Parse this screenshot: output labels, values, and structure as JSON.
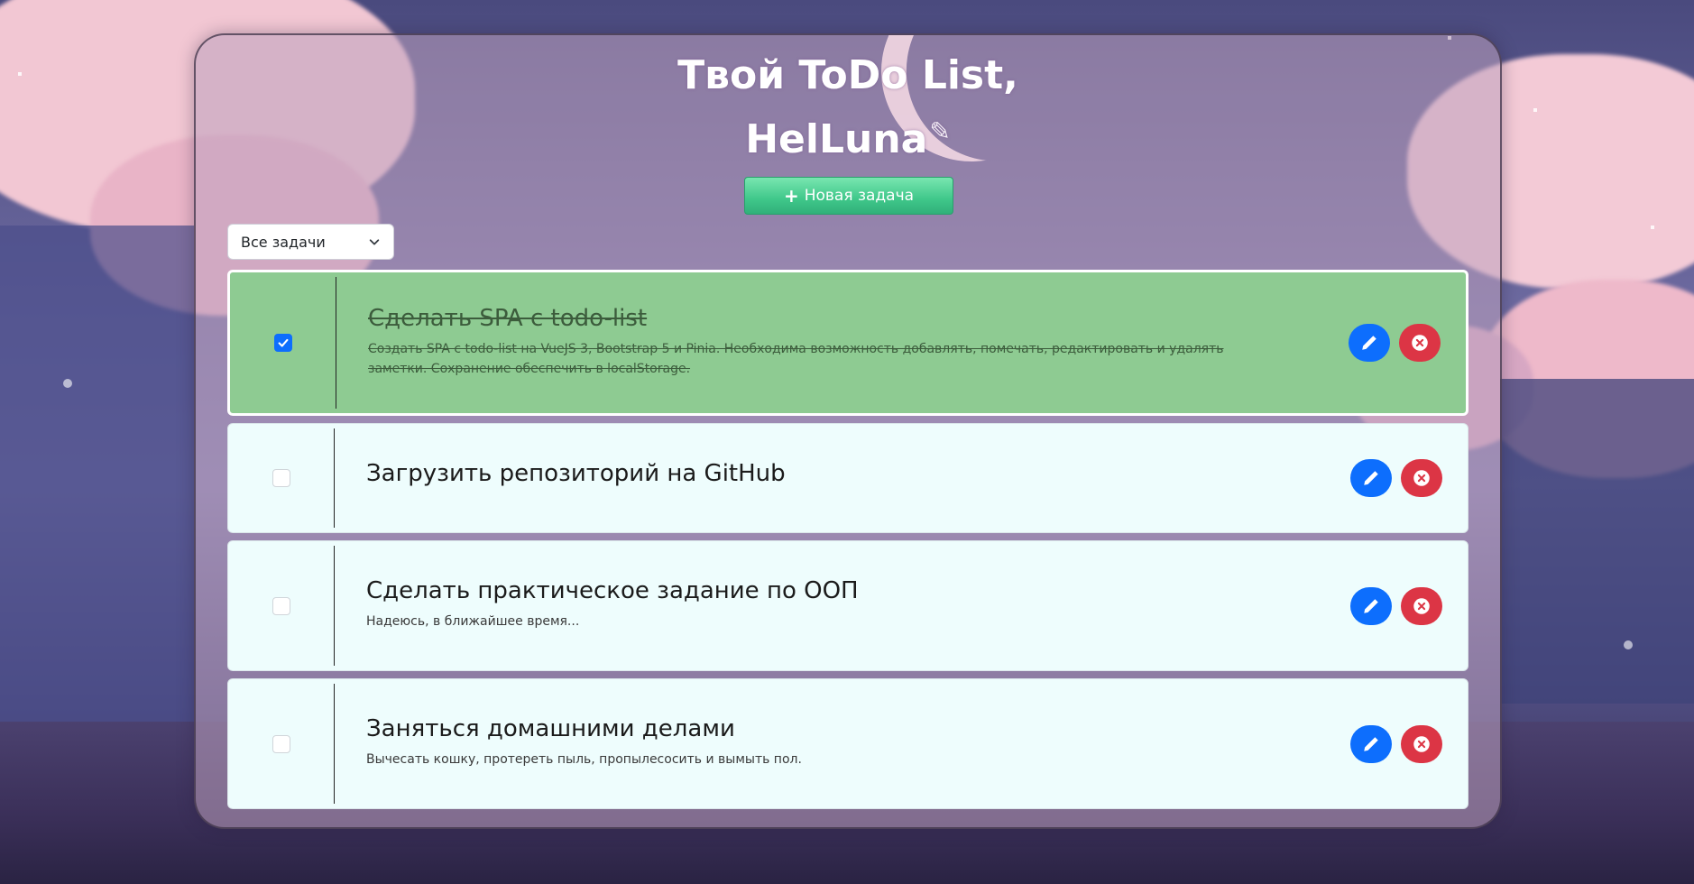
{
  "header": {
    "title_line1": "Твой ToDo List,",
    "title_line2": "HelLuna",
    "edit_icon": "pencil-icon"
  },
  "toolbar": {
    "new_task_label": "Новая задача",
    "new_task_icon": "plus-icon"
  },
  "filter": {
    "selected": "Все задачи"
  },
  "tasks": [
    {
      "title": "Сделать SPA с todo-list",
      "description": "Создать SPA с todo-list на VueJS 3, Bootstrap 5 и Pinia. Необходима возможность добавлять, помечать, редактировать и удалять заметки. Сохранение обеспечить в localStorage.",
      "done": true
    },
    {
      "title": "Загрузить репозиторий на GitHub",
      "description": "",
      "done": false
    },
    {
      "title": "Сделать практическое задание по ООП",
      "description": "Надеюсь, в ближайшее время...",
      "done": false
    },
    {
      "title": "Заняться домашними делами",
      "description": "Вычесать кошку, протереть пыль, пропылесосить и вымыть пол.",
      "done": false
    }
  ],
  "colors": {
    "done_bg": "#8ecb92",
    "card_bg": "#eefdfd",
    "edit_button": "#0d6efd",
    "delete_button": "#dc3545",
    "new_task_button": "#3fc78a"
  }
}
